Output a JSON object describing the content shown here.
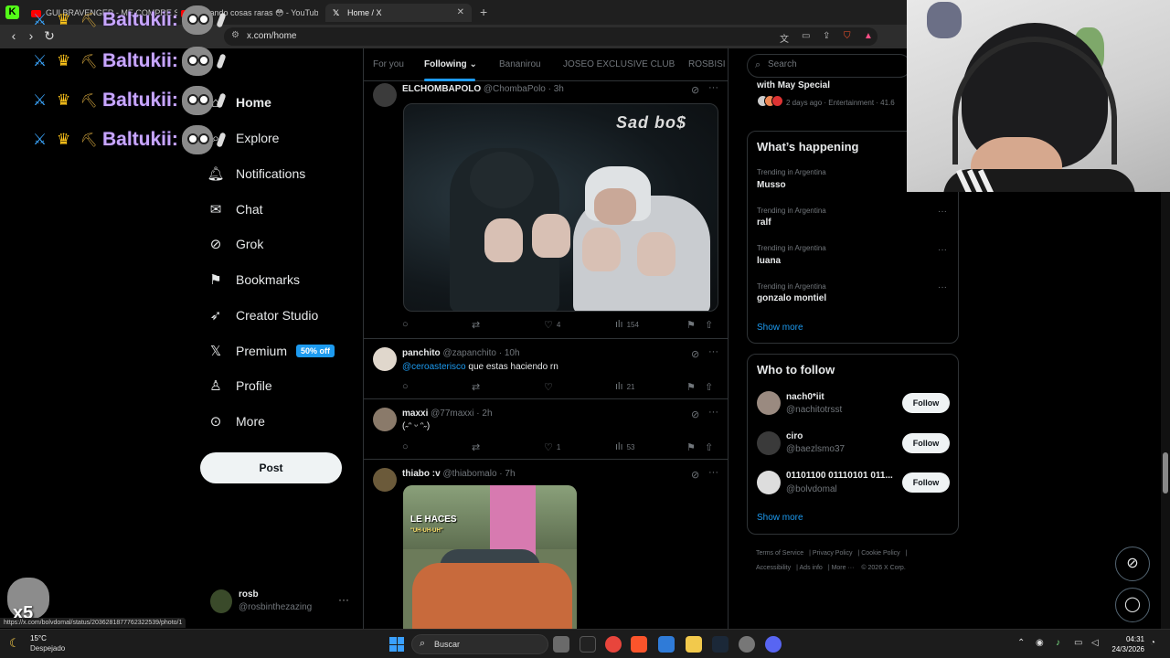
{
  "browser": {
    "tabs": [
      {
        "label": "GUI BRAVENGER - ME COMPRE SPLIT"
      },
      {
        "label": "mprando cosas raras 😳 - YouTube"
      },
      {
        "label": "Home / X"
      }
    ],
    "url": "x.com/home"
  },
  "chat_overlay": {
    "username": "Baltukii:",
    "line_count": 4
  },
  "nav": {
    "items": [
      {
        "label": "Home",
        "icon": "home-icon"
      },
      {
        "label": "Explore",
        "icon": "search-icon"
      },
      {
        "label": "Notifications",
        "icon": "bell-icon"
      },
      {
        "label": "Chat",
        "icon": "mail-icon"
      },
      {
        "label": "Grok",
        "icon": "grok-icon"
      },
      {
        "label": "Bookmarks",
        "icon": "bookmark-icon"
      },
      {
        "label": "Creator Studio",
        "icon": "rocket-icon"
      },
      {
        "label": "Premium",
        "icon": "x-logo-icon",
        "badge": "50% off"
      },
      {
        "label": "Profile",
        "icon": "person-icon"
      },
      {
        "label": "More",
        "icon": "more-circle-icon"
      }
    ],
    "post_label": "Post",
    "account": {
      "name": "rosb",
      "handle": "@rosbinthezazing"
    }
  },
  "feed": {
    "tabs": [
      "For you",
      "Following",
      "Bananirou",
      "JOSEO EXCLUSIVE CLUB",
      "ROSBISI"
    ],
    "active_tab": "Following",
    "tweets": [
      {
        "name": "ELCHOMBAPOLO",
        "handle": "@ChombaPolo",
        "time": "3h",
        "text": "",
        "media_sign": "Sad bo$",
        "replies": "",
        "retweets": "",
        "likes": "4",
        "views": "154"
      },
      {
        "name": "panchito",
        "handle": "@zapanchito",
        "time": "10h",
        "mention": "@ceroasterisco",
        "text": " que estas haciendo rn",
        "replies": "",
        "retweets": "",
        "likes": "",
        "views": "21"
      },
      {
        "name": "maxxi",
        "handle": "@77maxxi",
        "time": "2h",
        "text": "(˶ᵔ ᵕ ᵔ˶)",
        "replies": "",
        "retweets": "",
        "likes": "1",
        "views": "53"
      },
      {
        "name": "thiabo :v",
        "handle": "@thiabomalo",
        "time": "7h",
        "text": "",
        "media_text": "LE HACES",
        "media_subtext": "\"UH-UH-UH\""
      }
    ]
  },
  "right": {
    "search_placeholder": "Search",
    "top_news": {
      "title": "with May Special",
      "meta": "2 days ago · Entertainment · 41.6"
    },
    "whats_happening": {
      "title": "What’s happening",
      "trends": [
        {
          "category": "Trending in Argentina",
          "name": "Musso"
        },
        {
          "category": "Trending in Argentina",
          "name": "ralf"
        },
        {
          "category": "Trending in Argentina",
          "name": "luana"
        },
        {
          "category": "Trending in Argentina",
          "name": "gonzalo montiel"
        }
      ],
      "show_more": "Show more"
    },
    "who_to_follow": {
      "title": "Who to follow",
      "users": [
        {
          "name": "nach0*iit",
          "handle": "@nachitotrsst"
        },
        {
          "name": "ciro",
          "handle": "@baezlsmo37"
        },
        {
          "name": "01101100 01110101 011...",
          "handle": "@bolvdomal"
        }
      ],
      "follow_label": "Follow",
      "show_more": "Show more"
    },
    "footer": [
      "Terms of Service",
      "Privacy Policy",
      "Cookie Policy",
      "Accessibility",
      "Ads info",
      "More ···",
      "© 2026 X Corp."
    ]
  },
  "status_url": "https://x.com/bolvdomal/status/2036281877762322539/photo/1",
  "overlay_badge": "x5",
  "taskbar": {
    "weather_temp": "15°C",
    "weather_cond": "Despejado",
    "search_label": "Buscar",
    "time": "04:31",
    "date": "24/3/2026"
  },
  "colors": {
    "accent": "#1d9bf0",
    "background": "#000000",
    "chat_name": "#c8a6ff"
  }
}
